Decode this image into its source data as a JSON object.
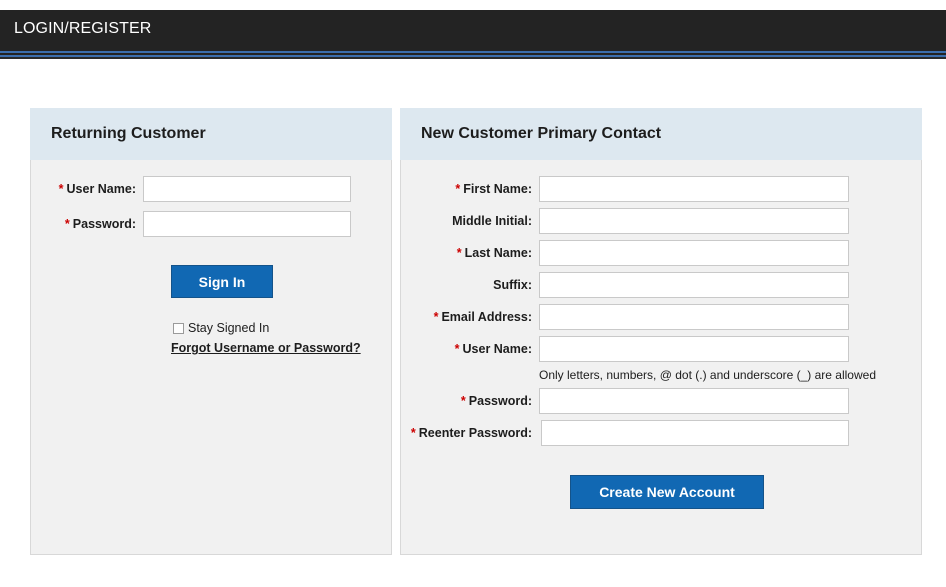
{
  "header": {
    "title": "LOGIN/REGISTER",
    "bar_color": "#232323",
    "accent_color": "#3c6ead"
  },
  "returning_customer": {
    "heading": "Returning Customer",
    "fields": [
      {
        "label": "User Name:",
        "required": true,
        "value": "",
        "placeholder": ""
      },
      {
        "label": "Password:",
        "required": true,
        "value": "",
        "placeholder": ""
      }
    ],
    "sign_in_label": "Sign In",
    "stay_signed_in_label": "Stay Signed In",
    "stay_signed_in_checked": false,
    "forgot_link_label": "Forgot Username or Password?"
  },
  "new_customer": {
    "heading": "New Customer Primary Contact",
    "fields": [
      {
        "label": "First Name:",
        "required": true,
        "value": "",
        "placeholder": ""
      },
      {
        "label": "Middle Initial:",
        "required": false,
        "value": "",
        "placeholder": ""
      },
      {
        "label": "Last Name:",
        "required": true,
        "value": "",
        "placeholder": ""
      },
      {
        "label": "Suffix:",
        "required": false,
        "value": "",
        "placeholder": ""
      },
      {
        "label": "Email Address:",
        "required": true,
        "value": "",
        "placeholder": ""
      },
      {
        "label": "User Name:",
        "required": true,
        "value": "",
        "placeholder": ""
      },
      {
        "label": "Password:",
        "required": true,
        "value": "",
        "placeholder": ""
      },
      {
        "label": "Reenter Password:",
        "required": true,
        "value": "",
        "placeholder": ""
      }
    ],
    "username_hint": "Only letters, numbers, @ dot (.) and underscore (_) are allowed",
    "create_account_label": "Create New Account"
  },
  "colors": {
    "button_blue": "#1168b3",
    "panel_header_blue": "#dde8f0",
    "panel_body_gray": "#f1f1f1",
    "required_red": "#cc0000"
  }
}
